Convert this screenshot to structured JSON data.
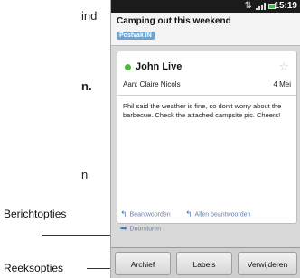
{
  "side_text": {
    "line1": "ind",
    "line2": "n.",
    "line3": "n"
  },
  "callouts": {
    "message_options": "Berichtopties",
    "thread_options": "Reeksopties"
  },
  "statusbar": {
    "time": "15:19"
  },
  "message": {
    "subject": "Camping out this weekend",
    "folder": "Postvak IN",
    "sender": "John Live",
    "to": "Aan: Claire Nicols",
    "date": "4 Mei",
    "body": "Phil said the weather is fine, so don't worry about the barbecue. Check the attached campsite pic. Cheers!"
  },
  "message_actions": {
    "reply": "Beantwoorden",
    "reply_all": "Allen beantwoorden",
    "forward": "Doorsturen"
  },
  "toolbar": {
    "archive": "Archief",
    "labels": "Labels",
    "delete": "Verwijderen"
  },
  "colors": {
    "presence": "#4dbb3a",
    "folder_badge": "#6aa3d6",
    "battery": "#4caf50"
  }
}
